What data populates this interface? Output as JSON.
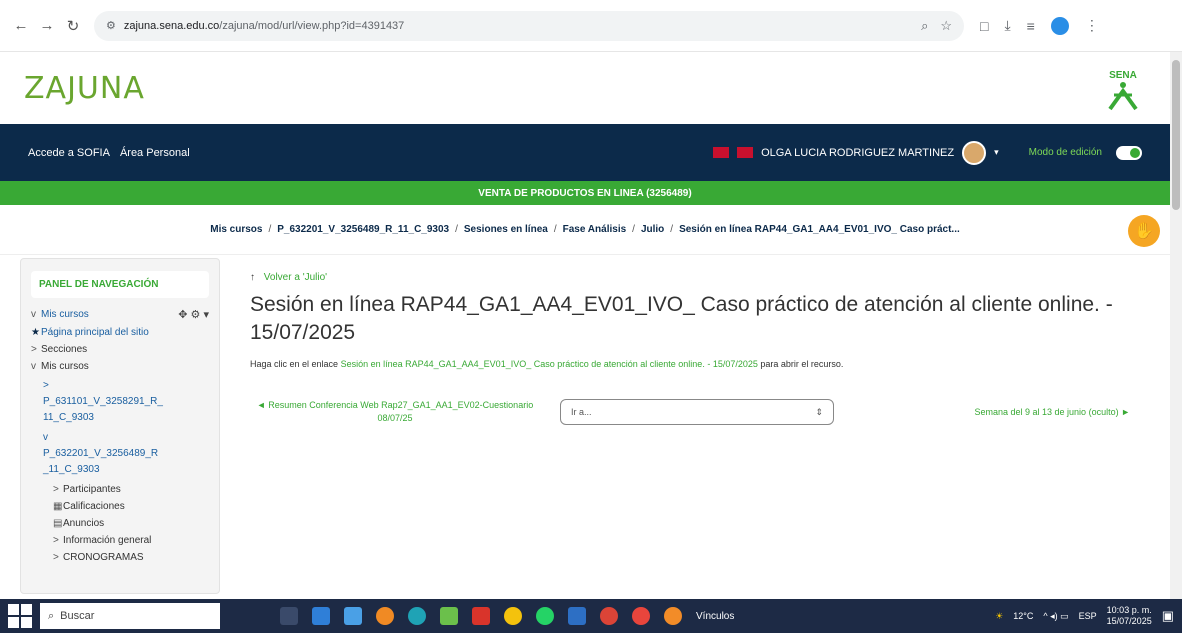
{
  "browser": {
    "url_host": "zajuna.sena.edu.co",
    "url_path": "/zajuna/mod/url/view.php?id=4391437"
  },
  "site": {
    "logo_text": "ZAJUNA",
    "sena_text": "SENA"
  },
  "topnav": {
    "links": [
      "Accede a SOFIA",
      "Área Personal"
    ],
    "user_name": "OLGA LUCIA RODRIGUEZ MARTINEZ",
    "edit_mode_label": "Modo de edición"
  },
  "course_bar": "VENTA DE PRODUCTOS EN LINEA (3256489)",
  "breadcrumb": [
    "Mis cursos",
    "P_632201_V_3256489_R_11_C_9303",
    "Sesiones en línea",
    "Fase Análisis",
    "Julio",
    "Sesión en línea RAP44_GA1_AA4_EV01_IVO_ Caso práct..."
  ],
  "leftnav": {
    "heading": "PANEL DE NAVEGACIÓN",
    "items": [
      {
        "indent": "v",
        "label": "Mis cursos"
      },
      {
        "indent": "★",
        "label": "Página principal del sitio"
      },
      {
        "indent": ">",
        "label": "Secciones"
      },
      {
        "indent": "v",
        "label": "Mis cursos"
      }
    ],
    "course1_indent": ">",
    "course1": "P_631101_V_3258291_R_11_C_9303",
    "course2_indent": "v",
    "course2": "P_632201_V_3256489_R_11_C_9303",
    "subitems": [
      {
        "indent": ">",
        "label": "Participantes"
      },
      {
        "indent": "▦",
        "label": "Calificaciones"
      },
      {
        "indent": "▤",
        "label": "Anuncios"
      },
      {
        "indent": ">",
        "label": "Información general"
      },
      {
        "indent": ">",
        "label": "CRONOGRAMAS"
      }
    ]
  },
  "main": {
    "back_label": "Volver a 'Julio'",
    "title": "Sesión en línea RAP44_GA1_AA4_EV01_IVO_ Caso práctico de atención al cliente online. - 15/07/2025",
    "instruction_prefix": "Haga clic en el enlace",
    "instruction_link": "Sesión en línea RAP44_GA1_AA4_EV01_IVO_ Caso práctico de atención al cliente online. - 15/07/2025",
    "instruction_suffix": "para abrir el recurso.",
    "prev_activity": "◄ Resumen Conferencia Web Rap27_GA1_AA1_EV02-Cuestionario 08/07/25",
    "jump_placeholder": "Ir a...",
    "next_activity": "Semana del 9 al 13 de junio (oculto) ►"
  },
  "taskbar": {
    "search_placeholder": "Buscar",
    "weather_label": "Vínculos",
    "temperature": "12°C",
    "lang": "ESP",
    "time": "10:03 p. m.",
    "date": "15/07/2025"
  }
}
